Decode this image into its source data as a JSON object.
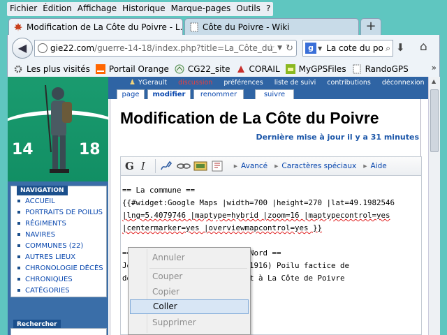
{
  "menu": [
    "Fichier",
    "Édition",
    "Affichage",
    "Historique",
    "Marque-pages",
    "Outils",
    "?"
  ],
  "tabs": [
    {
      "title": "Modification de La Côte du Poivre - L...",
      "active": true
    },
    {
      "title": "Côte du Poivre - Wiki",
      "active": false
    }
  ],
  "newtab_label": "+",
  "url": {
    "host": "gie22.com",
    "path": "/guerre-14-18/index.php?title=La_Côte_du_"
  },
  "search": {
    "value": "La cote du po"
  },
  "bookmarks": [
    "Les plus visités",
    "Portail Orange",
    "CG22_site",
    "CORAIL",
    "MyGPSFiles",
    "RandoGPS"
  ],
  "bookmarks_more": "»",
  "wiki": {
    "banner": {
      "left": "14",
      "right": "18"
    },
    "user_links": [
      "YGerault",
      "discussion",
      "préférences",
      "liste de suivi",
      "contributions",
      "déconnexion"
    ],
    "page_tabs": [
      "page",
      "modifier",
      "renommer",
      "suivre"
    ],
    "navigation_title": "NAVIGATION",
    "navigation": [
      "ACCUEIL",
      "PORTRAITS DE POILUS",
      "RÉGIMENTS",
      "NAVIRES",
      "COMMUNES (22)",
      "AUTRES LIEUX",
      "CHRONOLOGIE DÉCÈS",
      "CHRONIQUES",
      "CATÉGORIES"
    ],
    "search_title": "Rechercher",
    "title": "Modification de La Côte du Poivre",
    "updated": "Dernière mise à jour il y a 31 minutes",
    "toolbar": {
      "bold": "G",
      "italic": "I",
      "advanced": "Avancé",
      "special_chars": "Caractères spéciaux",
      "help": "Aide"
    },
    "editor_lines": [
      "== La commune ==",
      "{{#widget:Google Maps |width=700 |height=270 |lat=49.1982546",
      "|lng=5.4079746 |maptype=hybrid |zoom=16 |maptypecontrol=yes",
      "|centermarker=yes |overviewmapcontrol=yes }}",
      "",
      "==                    es-du-Nord ==",
      "Je                      882-1916) Poilu factice de",
      "dé                     vement à La Côte de Poivre"
    ]
  },
  "context_menu": [
    {
      "label": "Annuler",
      "enabled": false
    },
    {
      "label": "Couper",
      "enabled": false
    },
    {
      "label": "Copier",
      "enabled": false
    },
    {
      "label": "Coller",
      "enabled": true
    },
    {
      "label": "Supprimer",
      "enabled": false
    }
  ],
  "colors": {
    "desktop": "#5fc6c0",
    "wiki_blue": "#2f64a4",
    "banner_green": "#1a9b6f"
  }
}
